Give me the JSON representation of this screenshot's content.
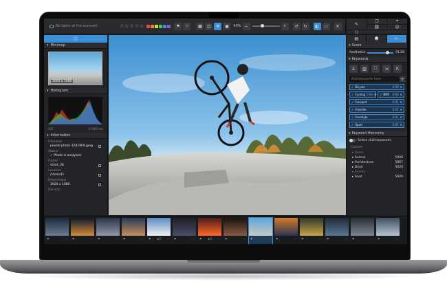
{
  "toolbar": {
    "status_message": "No tasks at the moment",
    "zoom": "40%"
  },
  "left_panel": {
    "sections": {
      "minimap": "Minimap",
      "histogram": "Histogram",
      "information": "Information"
    },
    "minimap_label": "1600 x 1080",
    "histogram_caption_left": "ISO",
    "histogram_caption_right": "1/1600 sec",
    "info": {
      "filename_label": "Filename",
      "filename_value": "pexels-photo-3281909.jpeg",
      "status_label": "Status",
      "status_value": "Photo is analyzed",
      "folder_label": "Folder",
      "folder_value": "stock_2K",
      "location_label": "Location",
      "location_value": "/Users/Er",
      "dimensions_label": "Dimensions",
      "dimensions_value": "1920 x 1080",
      "filesize_label": "File size"
    }
  },
  "right_panel": {
    "score_section": "Score",
    "aesthetics_label": "Aesthetics",
    "aesthetics_value": "91.58",
    "keywords_section": "Keywords",
    "keyword_input_placeholder": "Add keywords here",
    "keywords": [
      {
        "name": "Bicycle",
        "score": "0.99",
        "width": "full"
      },
      {
        "name": "Cycling",
        "score": "0.93",
        "width": "half"
      },
      {
        "name": "BMX",
        "score": "0.93",
        "width": "half"
      },
      {
        "name": "Funsport",
        "score": "0.91",
        "width": "full"
      },
      {
        "name": "Freeride",
        "score": "0.91",
        "width": "full"
      },
      {
        "name": "Freestyle",
        "score": "0.91",
        "width": "full"
      },
      {
        "name": "Sport",
        "score": "0.91",
        "width": "full"
      }
    ],
    "hierarchy_section": "Keyword Hierarchy",
    "select_child_label": "Select child keywords",
    "hierarchy_header": "Custom",
    "tree": [
      {
        "label": "Dates",
        "count": "",
        "dim": true
      },
      {
        "label": "Animal",
        "count": "5900",
        "dim": false
      },
      {
        "label": "Architecture",
        "count": "5867",
        "dim": false
      },
      {
        "label": "Drink",
        "count": "5929",
        "dim": false
      },
      {
        "label": "Events",
        "count": "",
        "dim": true
      },
      {
        "label": "Food",
        "count": "5929",
        "dim": false
      }
    ]
  },
  "filmstrip": [
    {
      "c1": "#1c2a3a",
      "c2": "#6b7d93",
      "stars": ""
    },
    {
      "c1": "#0f1a2b",
      "c2": "#d28a3c",
      "stars": ""
    },
    {
      "c1": "#2b3447",
      "c2": "#8f97a8",
      "stars": ""
    },
    {
      "c1": "#243c59",
      "c2": "#c78d5a",
      "stars": ""
    },
    {
      "c1": "#5a8bc4",
      "c2": "#f1f1f1",
      "stars": "2"
    },
    {
      "c1": "#1d1d25",
      "c2": "#4a4f66",
      "stars": ""
    },
    {
      "c1": "#4e1a1a",
      "c2": "#ff6a2a",
      "stars": "5"
    },
    {
      "c1": "#1a1410",
      "c2": "#8a5a44",
      "stars": ""
    },
    {
      "c1": "#5aa6d8",
      "c2": "#c9c9c5",
      "stars": ""
    },
    {
      "c1": "#d67a2a",
      "c2": "#2b3350",
      "stars": ""
    },
    {
      "c1": "#2f3a2a",
      "c2": "#c7a24a",
      "stars": ""
    },
    {
      "c1": "#1e2a38",
      "c2": "#5a7890",
      "stars": ""
    },
    {
      "c1": "#2a2d33",
      "c2": "#7d8593",
      "stars": ""
    },
    {
      "c1": "#3d4f63",
      "c2": "#b7c3cf",
      "stars": ""
    }
  ],
  "colors": {
    "accent": "#3a8fd8",
    "panel": "#232427",
    "label_red": "#e04848",
    "label_orange": "#e08a2e",
    "label_yellow": "#e3d23a",
    "label_green": "#4fbf4a",
    "label_blue": "#3a8fd8",
    "label_purple": "#a04fcf"
  }
}
